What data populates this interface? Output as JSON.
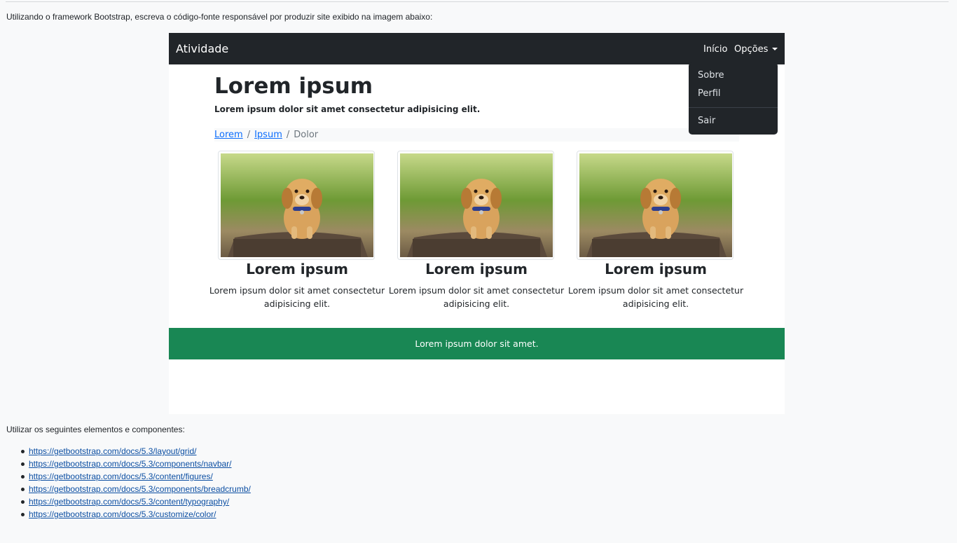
{
  "instructions": {
    "intro": "Utilizando o framework Bootstrap, escreva o código-fonte responsável por produzir site exibido na imagem abaixo:",
    "elements_title": "Utilizar os seguintes elementos e componentes:",
    "links": [
      "https://getbootstrap.com/docs/5.3/layout/grid/",
      "https://getbootstrap.com/docs/5.3/components/navbar/",
      "https://getbootstrap.com/docs/5.3/content/figures/",
      "https://getbootstrap.com/docs/5.3/components/breadcrumb/",
      "https://getbootstrap.com/docs/5.3/content/typography/",
      "https://getbootstrap.com/docs/5.3/customize/color/"
    ]
  },
  "site": {
    "brand": "Atividade",
    "nav": {
      "inicio": "Início",
      "opcoes": "Opções"
    },
    "dropdown": [
      "Sobre",
      "Perfil",
      "Sair"
    ],
    "heading": "Lorem ipsum",
    "lead": "Lorem ipsum dolor sit amet consectetur adipisicing elit.",
    "breadcrumb": [
      "Lorem",
      "Ipsum",
      "Dolor"
    ],
    "cards": [
      {
        "title": "Lorem ipsum",
        "text": "Lorem ipsum dolor sit amet consectetur adipisicing elit.",
        "image": "puppy-photo"
      },
      {
        "title": "Lorem ipsum",
        "text": "Lorem ipsum dolor sit amet consectetur adipisicing elit.",
        "image": "puppy-photo"
      },
      {
        "title": "Lorem ipsum",
        "text": "Lorem ipsum dolor sit amet consectetur adipisicing elit.",
        "image": "puppy-photo"
      }
    ],
    "footer": "Lorem ipsum dolor sit amet.",
    "colors": {
      "navbar": "#212529",
      "footer": "#198754",
      "link": "#0d6efd"
    }
  }
}
